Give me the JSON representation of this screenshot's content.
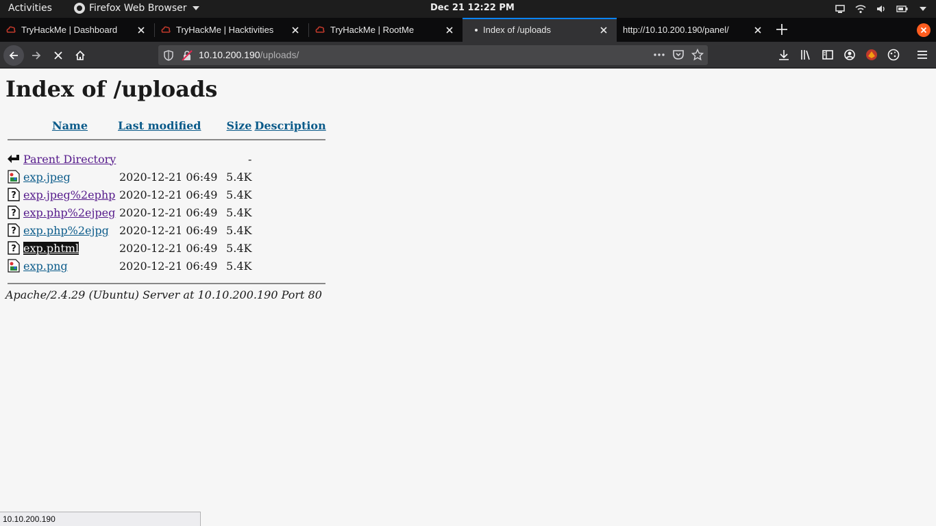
{
  "system": {
    "activities": "Activities",
    "app_name": "Firefox Web Browser",
    "clock": "Dec 21  12:22 PM"
  },
  "tabs": [
    {
      "title": "TryHackMe | Dashboard",
      "favicon": "tryhackme-icon"
    },
    {
      "title": "TryHackMe | Hacktivities",
      "favicon": "tryhackme-icon"
    },
    {
      "title": "TryHackMe | RootMe",
      "favicon": "tryhackme-icon"
    },
    {
      "title": "Index of /uploads",
      "favicon": "loading-dot",
      "active": true
    },
    {
      "title": "http://10.10.200.190/panel/",
      "favicon": "none"
    }
  ],
  "urlbar": {
    "host": "10.10.200.190",
    "path": "/uploads/"
  },
  "page": {
    "heading": "Index of /uploads",
    "columns": {
      "name": "Name",
      "last_modified": "Last modified",
      "size": "Size",
      "description": "Description"
    },
    "parent": {
      "name": "Parent Directory",
      "size": "-"
    },
    "files": [
      {
        "name": "exp.jpeg",
        "modified": "2020-12-21 06:49",
        "size": "5.4K",
        "icon": "image-icon"
      },
      {
        "name": "exp.jpeg%2ephp",
        "modified": "2020-12-21 06:49",
        "size": "5.4K",
        "icon": "unknown-file-icon"
      },
      {
        "name": "exp.php%2ejpeg",
        "modified": "2020-12-21 06:49",
        "size": "5.4K",
        "icon": "unknown-file-icon"
      },
      {
        "name": "exp.php%2ejpg",
        "modified": "2020-12-21 06:49",
        "size": "5.4K",
        "icon": "unknown-file-icon"
      },
      {
        "name": "exp.phtml",
        "modified": "2020-12-21 06:49",
        "size": "5.4K",
        "icon": "unknown-file-icon"
      },
      {
        "name": "exp.png",
        "modified": "2020-12-21 06:49",
        "size": "5.4K",
        "icon": "image-icon"
      }
    ],
    "server_signature": "Apache/2.4.29 (Ubuntu) Server at 10.10.200.190 Port 80"
  },
  "statusbar": {
    "text": "10.10.200.190"
  },
  "colors": {
    "tab_accent": "#0a84ff",
    "link": "#0b5b8a",
    "visited_link": "#551a8b",
    "alert": "#ff5d1f"
  }
}
